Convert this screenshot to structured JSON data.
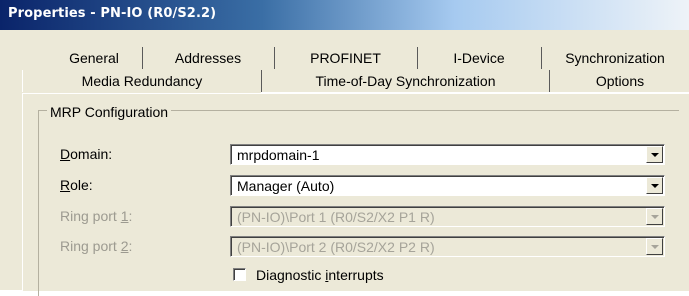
{
  "window": {
    "title": "Properties - PN-IO (R0/S2.2)"
  },
  "tabs_row1": [
    "General",
    "Addresses",
    "PROFINET",
    "I-Device",
    "Synchronization"
  ],
  "tabs_row2": [
    "Media Redundancy",
    "Time-of-Day Synchronization",
    "Options"
  ],
  "selected_tab": "Media Redundancy",
  "group": {
    "title": "MRP Configuration",
    "domain": {
      "label": "Domain:",
      "mnemonic": "D",
      "value": "mrpdomain-1",
      "enabled": true
    },
    "role": {
      "label": "Role:",
      "mnemonic": "R",
      "value": "Manager (Auto)",
      "enabled": true
    },
    "ring_port_1": {
      "label": "Ring port 1:",
      "mnemonic": "1",
      "value": "(PN-IO)\\Port 1 (R0/S2/X2 P1 R)",
      "enabled": false
    },
    "ring_port_2": {
      "label": "Ring port 2:",
      "mnemonic": "2",
      "value": "(PN-IO)\\Port 2 (R0/S2/X2 P2 R)",
      "enabled": false
    },
    "diagnostic_interrupts": {
      "label": "Diagnostic interrupts",
      "checked": false
    }
  }
}
